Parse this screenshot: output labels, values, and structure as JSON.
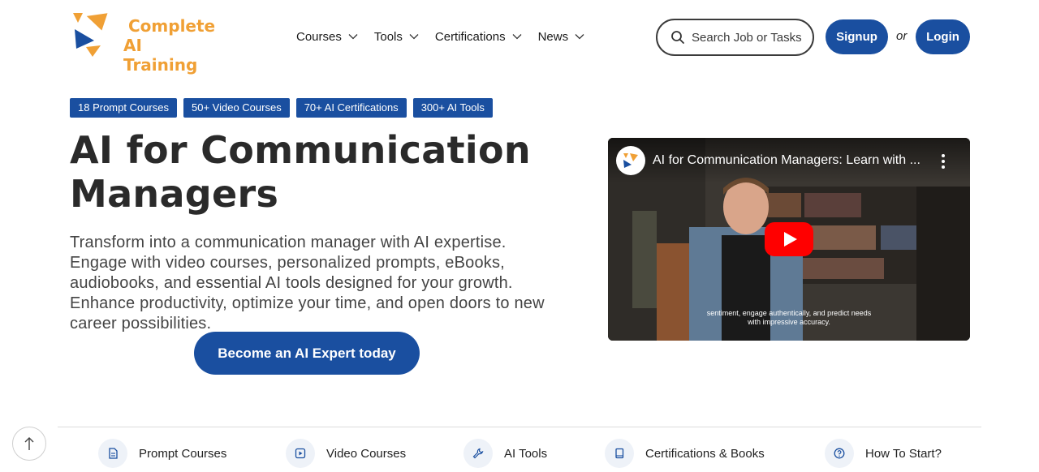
{
  "header": {
    "logo": {
      "line1": "Complete",
      "line2": "AI Training"
    },
    "nav": [
      {
        "label": "Courses",
        "icon": "chevron-down-icon"
      },
      {
        "label": "Tools",
        "icon": "chevron-down-icon"
      },
      {
        "label": "Certifications",
        "icon": "chevron-down-icon"
      },
      {
        "label": "News",
        "icon": "chevron-down-icon"
      }
    ],
    "search": {
      "placeholder": "Search Job or Tasks",
      "icon": "search-icon"
    },
    "signup_label": "Signup",
    "or_label": "or",
    "login_label": "Login"
  },
  "badges": [
    "18 Prompt Courses",
    "50+ Video Courses",
    "70+ AI Certifications",
    "300+ AI Tools"
  ],
  "hero": {
    "title_line1": "AI for Communication",
    "title_line2": "Managers",
    "description": "Transform into a communication manager with AI expertise. Engage with video courses, personalized prompts, eBooks, audiobooks, and essential AI tools designed for your growth. Enhance productivity, optimize your time, and open doors to new career possibilities.",
    "cta_label": "Become an AI Expert today"
  },
  "video": {
    "title": "AI for Communication Managers: Learn with ...",
    "caption_line1": "sentiment, engage authentically, and predict needs",
    "caption_line2": "with impressive accuracy.",
    "channel_avatar_text": "Complete AI Training"
  },
  "bottom_nav": [
    {
      "label": "Prompt Courses",
      "icon": "document-icon"
    },
    {
      "label": "Video Courses",
      "icon": "play-square-icon"
    },
    {
      "label": "AI Tools",
      "icon": "wrench-icon"
    },
    {
      "label": "Certifications & Books",
      "icon": "book-icon"
    },
    {
      "label": "How To Start?",
      "icon": "question-circle-icon"
    }
  ],
  "colors": {
    "primary": "#1a4fa0",
    "logo_orange": "#f0a035",
    "logo_blue": "#1a4fa0",
    "play_red": "#ff0000"
  }
}
